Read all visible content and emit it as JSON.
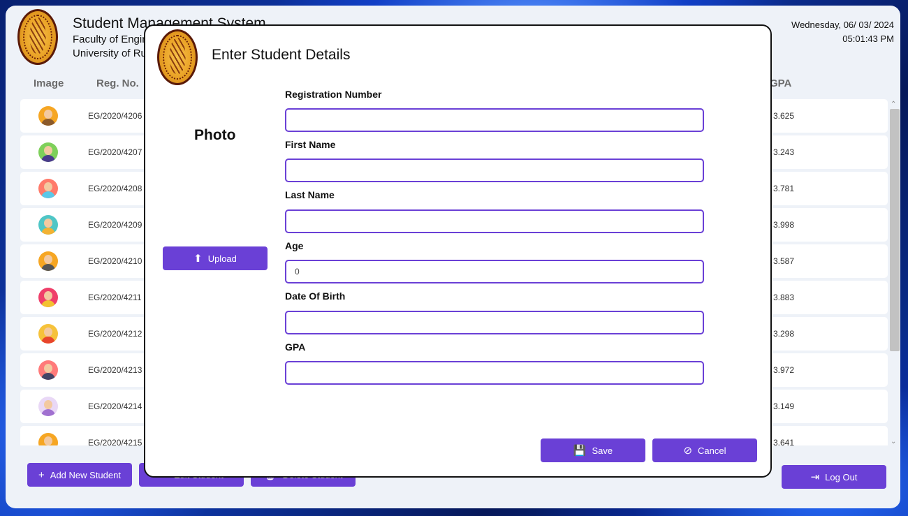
{
  "app": {
    "title": "Student Management System",
    "faculty": "Faculty of Engineering",
    "university": "University of Ruhuna",
    "date": "Wednesday, 06/ 03/ 2024",
    "time": "05:01:43 PM"
  },
  "table": {
    "columns": {
      "image": "Image",
      "reg_no": "Reg. No.",
      "gpa": "GPA"
    },
    "rows": [
      {
        "reg_no": "EG/2020/4206",
        "gpa": "3.625"
      },
      {
        "reg_no": "EG/2020/4207",
        "gpa": "3.243"
      },
      {
        "reg_no": "EG/2020/4208",
        "gpa": "3.781"
      },
      {
        "reg_no": "EG/2020/4209",
        "gpa": "3.998"
      },
      {
        "reg_no": "EG/2020/4210",
        "gpa": "3.587"
      },
      {
        "reg_no": "EG/2020/4211",
        "gpa": "3.883"
      },
      {
        "reg_no": "EG/2020/4212",
        "gpa": "3.298"
      },
      {
        "reg_no": "EG/2020/4213",
        "gpa": "3.972"
      },
      {
        "reg_no": "EG/2020/4214",
        "gpa": "3.149"
      },
      {
        "reg_no": "EG/2020/4215",
        "gpa": "3.641"
      }
    ],
    "avatar_colors": [
      {
        "bg": "#f6a623",
        "shirt": "#8b5a2b"
      },
      {
        "bg": "#7ed05a",
        "shirt": "#4a3b8c"
      },
      {
        "bg": "#ff7a6a",
        "shirt": "#5ac8e8"
      },
      {
        "bg": "#4fc6c6",
        "shirt": "#f2b233"
      },
      {
        "bg": "#f6a623",
        "shirt": "#555555"
      },
      {
        "bg": "#ef3f6a",
        "shirt": "#f2c230"
      },
      {
        "bg": "#f6c23a",
        "shirt": "#e8452c"
      },
      {
        "bg": "#ff7a7a",
        "shirt": "#444466"
      },
      {
        "bg": "#e9d8f6",
        "shirt": "#a070d0"
      },
      {
        "bg": "#f6a623",
        "shirt": "#444466"
      }
    ]
  },
  "bottom_bar": {
    "add_label": "Add New Student",
    "edit_label": "Edit Student",
    "delete_label": "Delete Student",
    "logout_label": "Log Out"
  },
  "dialog": {
    "title": "Enter Student Details",
    "photo_label": "Photo",
    "upload_label": "Upload",
    "fields": {
      "registration_number": {
        "label": "Registration Number",
        "value": ""
      },
      "first_name": {
        "label": "First Name",
        "value": ""
      },
      "last_name": {
        "label": "Last Name",
        "value": ""
      },
      "age": {
        "label": "Age",
        "value": "0"
      },
      "date_of_birth": {
        "label": "Date Of Birth",
        "value": ""
      },
      "gpa": {
        "label": "GPA",
        "value": ""
      }
    },
    "save_label": "Save",
    "cancel_label": "Cancel"
  },
  "colors": {
    "accent": "#6a40d6",
    "window_bg": "#eef2f8"
  }
}
